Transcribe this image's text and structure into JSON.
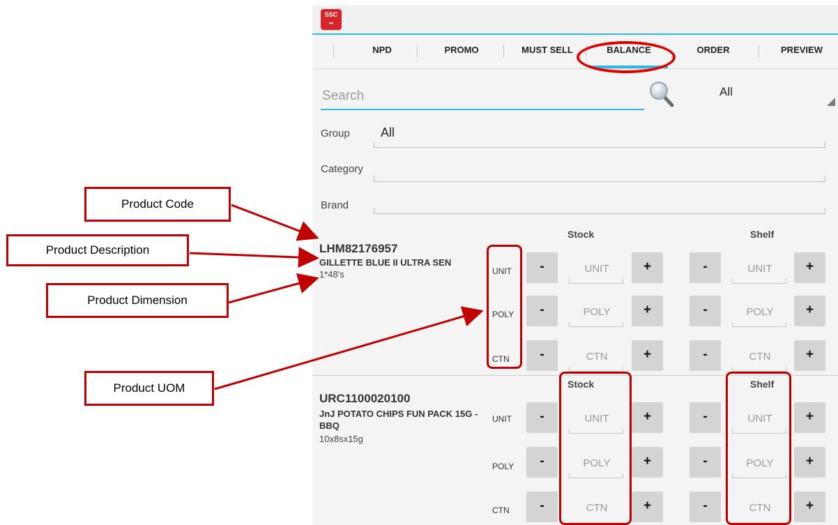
{
  "app": {
    "logo_text": "SSC"
  },
  "tabs": [
    {
      "label": "NPD"
    },
    {
      "label": "PROMO"
    },
    {
      "label": "MUST SELL"
    },
    {
      "label": "BALANCE"
    },
    {
      "label": "ORDER"
    },
    {
      "label": "PREVIEW"
    }
  ],
  "active_tab": "BALANCE",
  "search": {
    "placeholder": "Search",
    "filter_value": "All"
  },
  "filters": {
    "group_label": "Group",
    "group_value": "All",
    "category_label": "Category",
    "category_value": "",
    "brand_label": "Brand",
    "brand_value": ""
  },
  "columns": {
    "stock": "Stock",
    "shelf": "Shelf"
  },
  "uoms": [
    "UNIT",
    "POLY",
    "CTN"
  ],
  "buttons": {
    "minus": "-",
    "plus": "+"
  },
  "products": [
    {
      "code": "LHM82176957",
      "description": "GILLETTE BLUE II ULTRA SEN",
      "dimension": "1*48's"
    },
    {
      "code": "URC1100020100",
      "description": "JnJ POTATO CHIPS FUN PACK 15G - BBQ",
      "dimension": "10x8sx15g"
    }
  ],
  "annotations": {
    "product_code": "Product Code",
    "product_description": "Product Description",
    "product_dimension": "Product Dimension",
    "product_uom": "Product UOM"
  },
  "colors": {
    "accent": "#33b5e5",
    "annotation_red": "#c00000",
    "button_grey": "#d4d4d4"
  }
}
